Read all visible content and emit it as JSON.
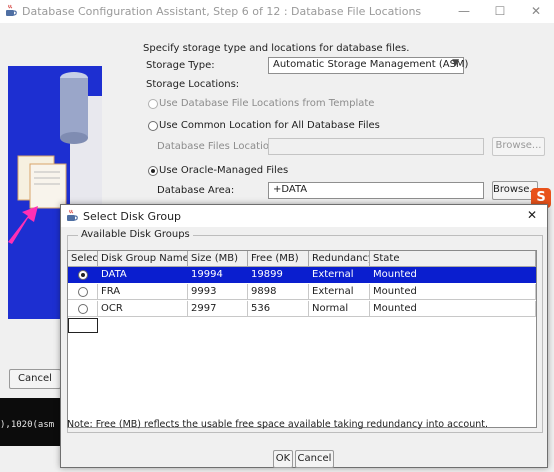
{
  "main_window": {
    "title": "Database Configuration Assistant, Step 6 of 12 : Database File Locations",
    "instructions": "Specify storage type and locations for database files.",
    "storage_type_label": "Storage Type:",
    "storage_type_value": "Automatic Storage Management (ASM)",
    "storage_locations_label": "Storage Locations:",
    "option_template": "Use Database File Locations from Template",
    "option_common": "Use Common Location for All Database Files",
    "database_files_location_label": "Database Files Location:",
    "database_files_location_value": "",
    "browse_label": "Browse...",
    "option_omf": "Use Oracle-Managed Files",
    "database_area_label": "Database Area:",
    "database_area_value": "+DATA",
    "browse2_label": "Browse...",
    "cancel_label": "Cancel"
  },
  "terminal": {
    "text": "),1020(asm"
  },
  "dialog": {
    "title": "Select Disk Group",
    "group_label": "Available Disk Groups",
    "columns": [
      "Select",
      "Disk Group Name",
      "Size (MB)",
      "Free (MB)",
      "Redundancy",
      "State"
    ],
    "rows": [
      {
        "name": "DATA",
        "size": "19994",
        "free": "19899",
        "redundancy": "External",
        "state": "Mounted",
        "selected": true
      },
      {
        "name": "FRA",
        "size": "9993",
        "free": "9898",
        "redundancy": "External",
        "state": "Mounted",
        "selected": false
      },
      {
        "name": "OCR",
        "size": "2997",
        "free": "536",
        "redundancy": "Normal",
        "state": "Mounted",
        "selected": false
      }
    ],
    "note": "Note:  Free (MB) reflects the usable free space available taking redundancy into account.",
    "ok_label": "OK",
    "cancel_label": "Cancel"
  },
  "colors": {
    "selection": "#0a1ecf",
    "side_panel": "#1d2fd1",
    "ime_badge": "#e8521b"
  },
  "icons": [
    "java-cup-icon",
    "minimize-icon",
    "maximize-icon",
    "close-icon",
    "dropdown-arrow-icon",
    "sogou-ime-icon"
  ]
}
